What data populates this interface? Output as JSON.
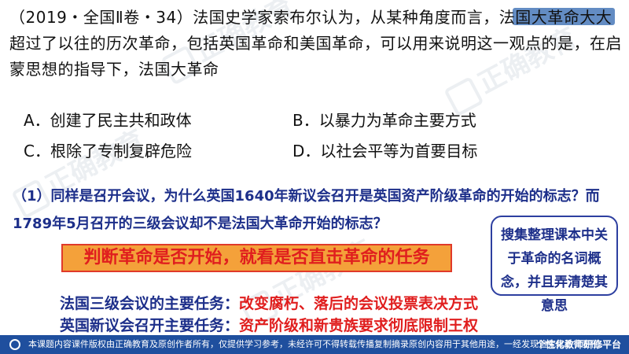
{
  "question": {
    "stem": "（2019・全国Ⅱ卷・34）法国史学家索布尔认为，从某种角度而言，法国大革命大大超过了以往的历次革命，包括英国革命和美国革命，可以用来说明这一观点的是，在启蒙思想的指导下，法国大革命",
    "options": {
      "a": "A．创建了民主共和政体",
      "b": "B．以暴力为革命主要方式",
      "c": "C．根除了专制复辟危险",
      "d": "D．以社会平等为首要目标"
    }
  },
  "sub_question": {
    "number": "（1）",
    "text": "同样是召开会议，为什么英国1640年新议会召开是英国资产阶级革命的开始的标志？而1789年5月召开的三级会议却不是法国大革命开始的标志？"
  },
  "side_note": "搜集整理课本中关于革命的名词概念，并且弄清楚其意思",
  "judge_box": "判断革命是否开始，就看是否直击革命的任务",
  "tasks": [
    {
      "label": "法国三级会议的主要任务：",
      "value": "改变腐朽、落后的会议投票表决方式"
    },
    {
      "label": "英国新议会召开主要任务：",
      "value": "资产阶级和新贵族要求彻底限制王权"
    }
  ],
  "watermark": "正确教育",
  "footer": {
    "notice": "本课题内容课件版权由正确教育及原创作者所有，仅提供学习参考，未经许可不得转载传播复制摘录原创内容用于其他用途，一经发现追究其法律责任。",
    "brand": "个性化教师研修平台"
  },
  "colors": {
    "navy": "#1d2f8a",
    "red": "#e01e1e",
    "orange": "#f4a13a",
    "footer_bg": "#1f4f9e"
  }
}
